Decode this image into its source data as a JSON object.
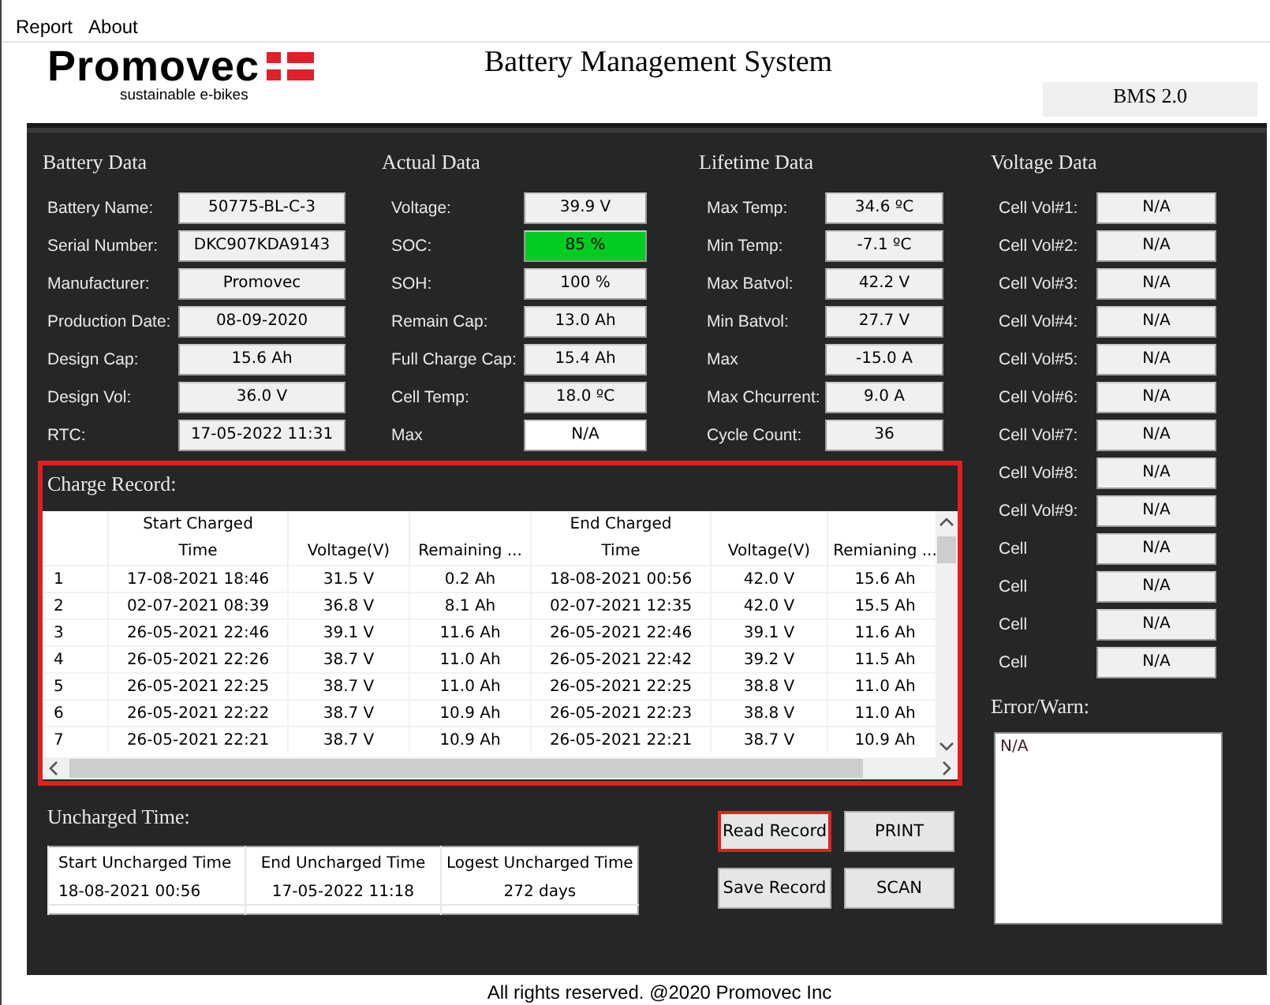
{
  "menu": [
    {
      "label": "Report"
    },
    {
      "label": "About"
    }
  ],
  "logo": {
    "name": "Promovec",
    "tagline": "sustainable e-bikes"
  },
  "title": "Battery Management System",
  "version": "BMS 2.0",
  "groups": [
    {
      "title": "Battery Data",
      "fields": [
        {
          "label": "Battery Name:",
          "value": "50775-BL-C-3"
        },
        {
          "label": "Serial Number:",
          "value": "DKC907KDA9143"
        },
        {
          "label": "Manufacturer:",
          "value": "Promovec"
        },
        {
          "label": "Production Date:",
          "value": "08-09-2020"
        },
        {
          "label": "Design Cap:",
          "value": "15.6 Ah"
        },
        {
          "label": "Design Vol:",
          "value": "36.0 V"
        },
        {
          "label": "RTC:",
          "value": "17-05-2022 11:31"
        }
      ]
    },
    {
      "title": "Actual Data",
      "fields": [
        {
          "label": "Voltage:",
          "value": "39.9 V"
        },
        {
          "label": "SOC:",
          "value": "85 %",
          "color": "#00cc22"
        },
        {
          "label": "SOH:",
          "value": "100 %"
        },
        {
          "label": "Remain Cap:",
          "value": "13.0 Ah"
        },
        {
          "label": "Full Charge Cap:",
          "value": "15.4 Ah"
        },
        {
          "label": "Cell Temp:",
          "value": "18.0 ºC"
        },
        {
          "label": "Max",
          "value": "N/A",
          "color": "#ffffff"
        }
      ]
    },
    {
      "title": "Lifetime Data",
      "fields": [
        {
          "label": "Max Temp:",
          "value": "34.6 ºC"
        },
        {
          "label": "Min Temp:",
          "value": "-7.1 ºC"
        },
        {
          "label": "Max Batvol:",
          "value": "42.2 V"
        },
        {
          "label": "Min Batvol:",
          "value": "27.7 V"
        },
        {
          "label": "Max",
          "value": "-15.0 A"
        },
        {
          "label": "Max Chcurrent:",
          "value": "9.0 A"
        },
        {
          "label": "Cycle Count:",
          "value": "36"
        }
      ]
    },
    {
      "title": "Voltage Data",
      "fields": [
        {
          "label": "Cell Vol#1:",
          "value": "N/A"
        },
        {
          "label": "Cell Vol#2:",
          "value": "N/A"
        },
        {
          "label": "Cell Vol#3:",
          "value": "N/A"
        },
        {
          "label": "Cell Vol#4:",
          "value": "N/A"
        },
        {
          "label": "Cell Vol#5:",
          "value": "N/A"
        },
        {
          "label": "Cell Vol#6:",
          "value": "N/A"
        },
        {
          "label": "Cell Vol#7:",
          "value": "N/A"
        },
        {
          "label": "Cell Vol#8:",
          "value": "N/A"
        },
        {
          "label": "Cell Vol#9:",
          "value": "N/A"
        },
        {
          "label": "Cell",
          "value": "N/A"
        },
        {
          "label": "Cell",
          "value": "N/A"
        },
        {
          "label": "Cell",
          "value": "N/A"
        },
        {
          "label": "Cell",
          "value": "N/A"
        }
      ]
    }
  ],
  "charge_record": {
    "title": "Charge Record:",
    "highlighted": true,
    "columns": [
      {
        "kind": "index"
      },
      {
        "kind": "data",
        "group": "Start Charged",
        "label": "Time"
      },
      {
        "kind": "data",
        "label": "Voltage(V)"
      },
      {
        "kind": "data",
        "label": "Remaining ..."
      },
      {
        "kind": "data",
        "group": "End Charged",
        "label": "Time"
      },
      {
        "kind": "data",
        "label": "Voltage(V)"
      },
      {
        "kind": "data",
        "label": "Remianing ..."
      }
    ],
    "rows": [
      [
        "1",
        "17-08-2021 18:46",
        "31.5 V",
        "0.2 Ah",
        "18-08-2021 00:56",
        "42.0 V",
        "15.6 Ah"
      ],
      [
        "2",
        "02-07-2021 08:39",
        "36.8 V",
        "8.1 Ah",
        "02-07-2021 12:35",
        "42.0 V",
        "15.5 Ah"
      ],
      [
        "3",
        "26-05-2021 22:46",
        "39.1 V",
        "11.6 Ah",
        "26-05-2021 22:46",
        "39.1 V",
        "11.6 Ah"
      ],
      [
        "4",
        "26-05-2021 22:26",
        "38.7 V",
        "11.0 Ah",
        "26-05-2021 22:42",
        "39.2 V",
        "11.5 Ah"
      ],
      [
        "5",
        "26-05-2021 22:25",
        "38.7 V",
        "11.0 Ah",
        "26-05-2021 22:25",
        "38.8 V",
        "11.0 Ah"
      ],
      [
        "6",
        "26-05-2021 22:22",
        "38.7 V",
        "10.9 Ah",
        "26-05-2021 22:23",
        "38.8 V",
        "11.0 Ah"
      ],
      [
        "7",
        "26-05-2021 22:21",
        "38.7 V",
        "10.9 Ah",
        "26-05-2021 22:21",
        "38.7 V",
        "10.9 Ah"
      ]
    ]
  },
  "uncharged": {
    "title": "Uncharged Time:",
    "columns": [
      "Start Uncharged Time",
      "End Uncharged Time",
      "Logest Uncharged Time"
    ],
    "rows": [
      [
        "18-08-2021 00:56",
        "17-05-2022 11:18",
        "272 days"
      ]
    ]
  },
  "buttons": [
    {
      "label": "Read Record",
      "highlighted": true
    },
    {
      "label": "PRINT",
      "highlighted": false
    },
    {
      "label": "Save Record",
      "highlighted": false
    },
    {
      "label": "SCAN",
      "highlighted": false
    }
  ],
  "error": {
    "title": "Error/Warn:",
    "value": "N/A"
  },
  "footer": "All rights reserved. @2020 Promovec Inc"
}
